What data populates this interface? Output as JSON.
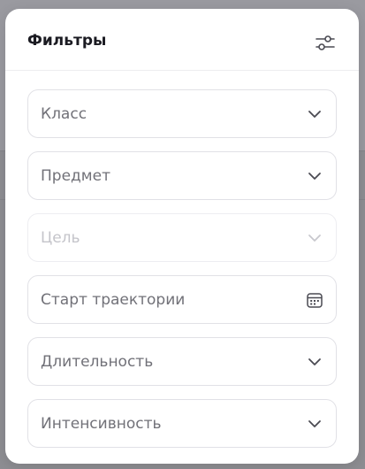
{
  "modal": {
    "title": "Фильтры"
  },
  "fields": [
    {
      "placeholder": "Класс",
      "icon": "chevron-down-icon",
      "disabled": false
    },
    {
      "placeholder": "Предмет",
      "icon": "chevron-down-icon",
      "disabled": false
    },
    {
      "placeholder": "Цель",
      "icon": "chevron-down-icon",
      "disabled": true
    },
    {
      "placeholder": "Старт траектории",
      "icon": "calendar-icon",
      "disabled": false
    },
    {
      "placeholder": "Длительность",
      "icon": "chevron-down-icon",
      "disabled": false
    },
    {
      "placeholder": "Интенсивность",
      "icon": "chevron-down-icon",
      "disabled": false
    }
  ],
  "colors": {
    "backdrop": "#8e8e93",
    "modal_bg": "#ffffff",
    "field_border": "#e1e1e6",
    "placeholder_text": "#717178",
    "disabled_text": "#c4c4ca",
    "title_text": "#1b1b22"
  }
}
